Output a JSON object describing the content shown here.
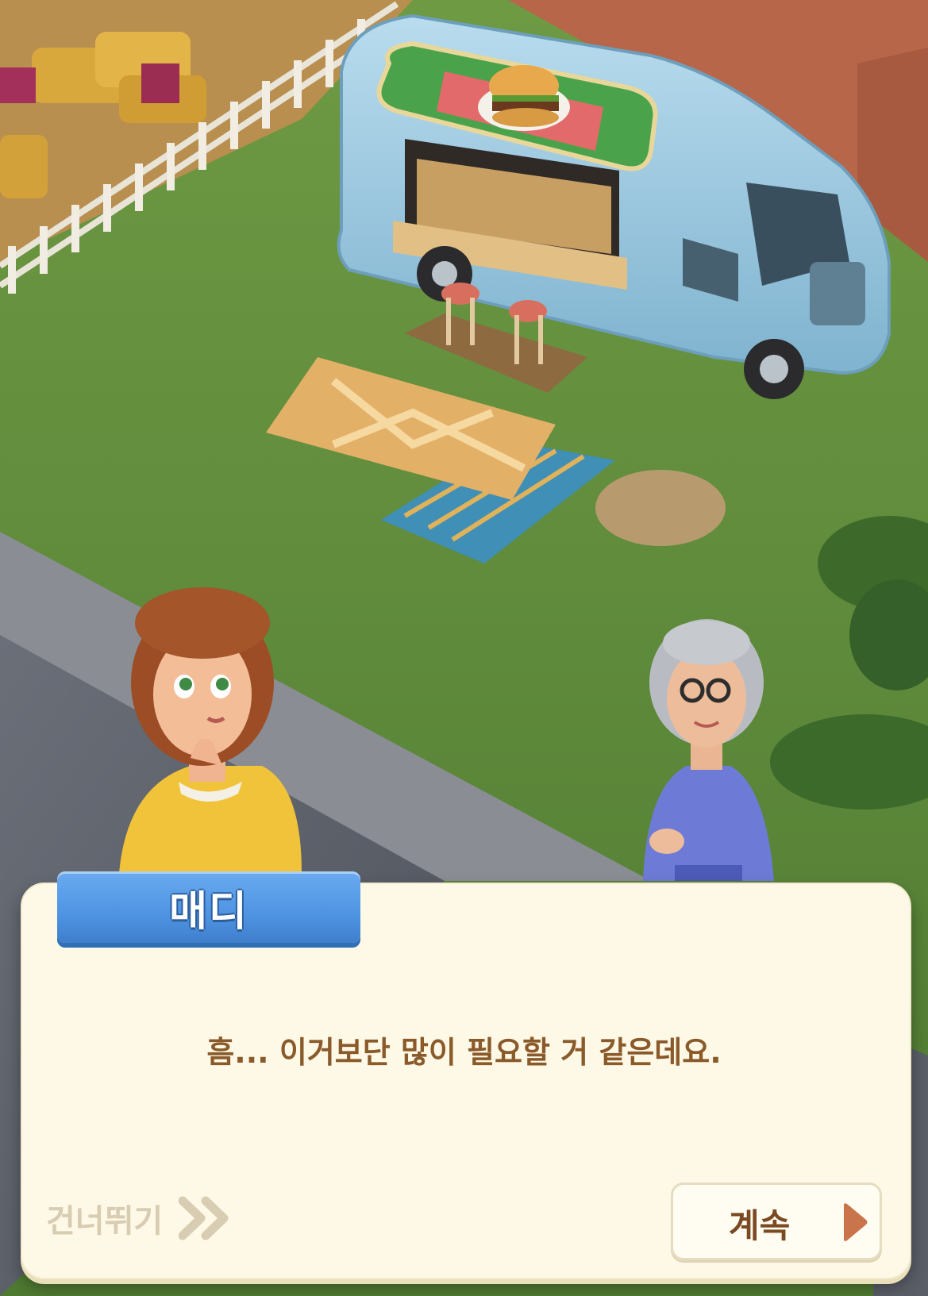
{
  "dialog": {
    "speaker_name": "매디",
    "message": "흠... 이거보단 많이 필요할 거 같은데요.",
    "skip_label": "건너뛰기",
    "continue_label": "계속"
  },
  "icons": {
    "skip": "double-chevron-right-icon",
    "continue": "play-triangle-icon"
  },
  "colors": {
    "name_tag": "#4f94e3",
    "dialog_bg": "#fdf9e6",
    "message_text": "#8a5a2a",
    "skip_text": "#d8ccb2",
    "continue_text": "#7a4a22"
  }
}
